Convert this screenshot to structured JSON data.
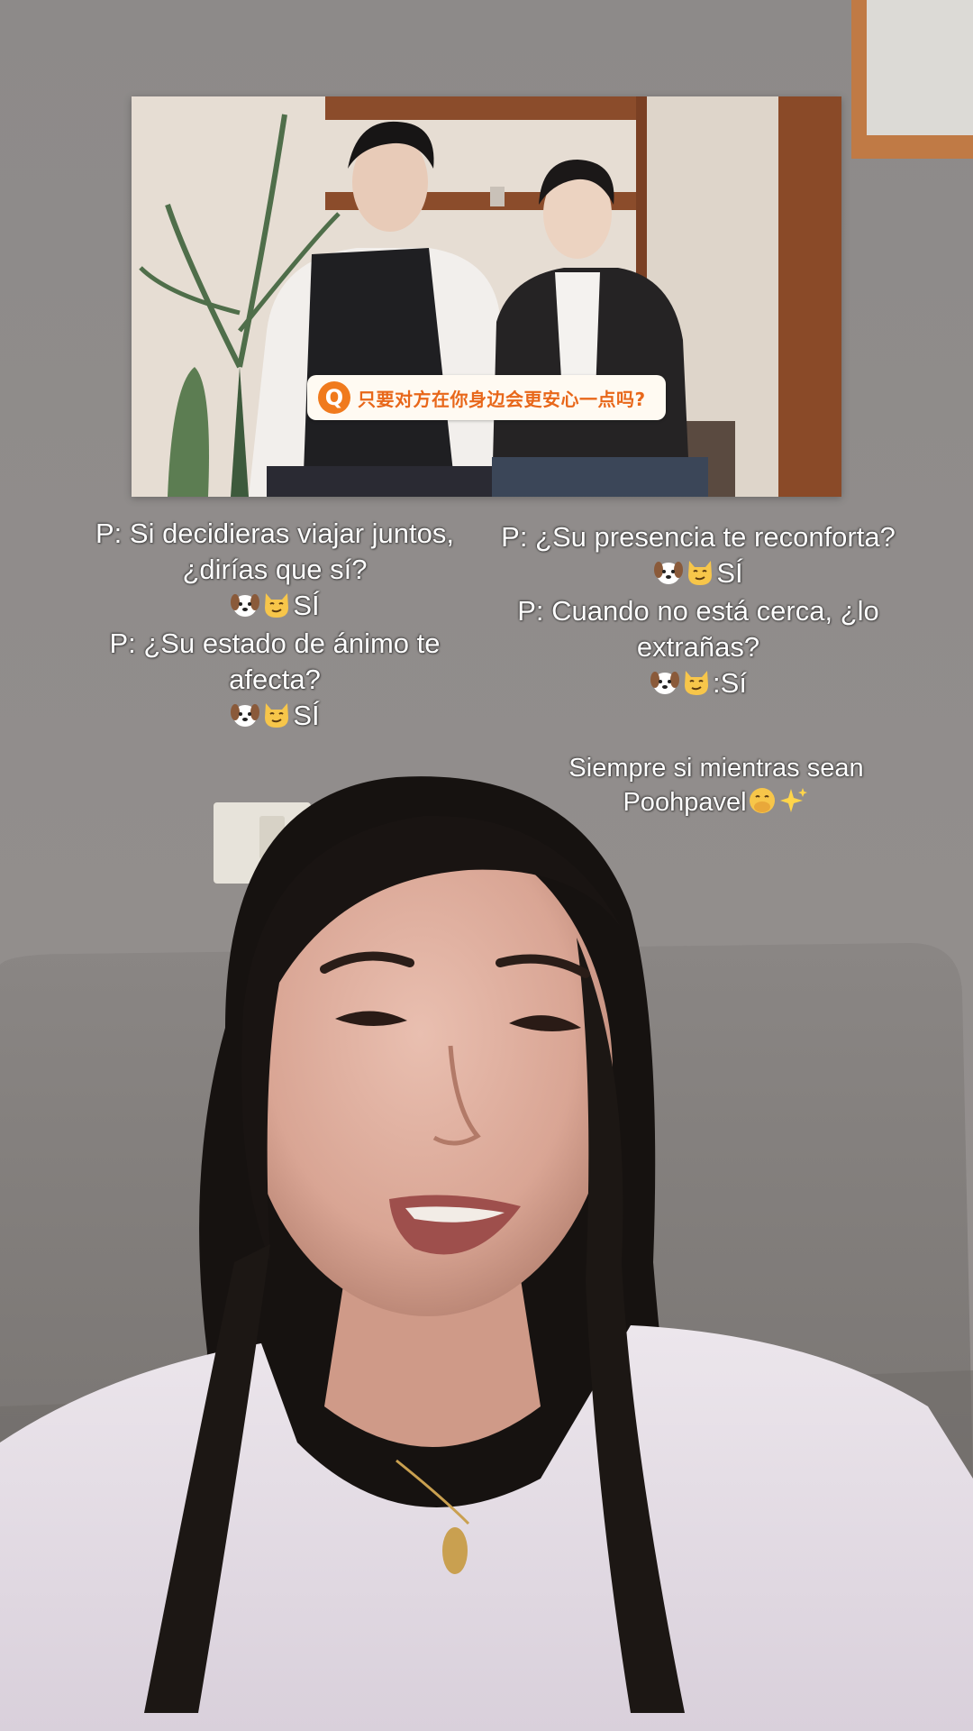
{
  "clip": {
    "caption_mark": "Q",
    "caption_text": "只要对方在你身边会更安心一点吗?"
  },
  "captions": {
    "left": [
      {
        "question": "P: Si decidieras viajar juntos, ¿dirías que sí?",
        "emojis": [
          "dog-face-icon",
          "cat-face-icon"
        ],
        "answer": "SÍ"
      },
      {
        "question": "P: ¿Su estado de ánimo te afecta?",
        "emojis": [
          "dog-face-icon",
          "cat-face-icon"
        ],
        "answer": "SÍ"
      }
    ],
    "right": [
      {
        "question": "P: ¿Su presencia te reconforta?",
        "emojis": [
          "dog-face-icon",
          "cat-face-icon"
        ],
        "answer": "SÍ"
      },
      {
        "question": "P: Cuando no está cerca, ¿lo extrañas?",
        "emojis": [
          "dog-face-icon",
          "cat-face-icon"
        ],
        "answer": ":Sí"
      }
    ],
    "note": {
      "line1": "Siempre si mientras sean",
      "line2": "Poohpavel",
      "emojis": [
        "face-with-hand-over-mouth-icon",
        "sparkles-icon"
      ]
    }
  },
  "colors": {
    "wall": "#8f8b8a",
    "couch": "#807c79",
    "caption_text": "#ffffff",
    "clip_caption_accent": "#f07a1d"
  }
}
